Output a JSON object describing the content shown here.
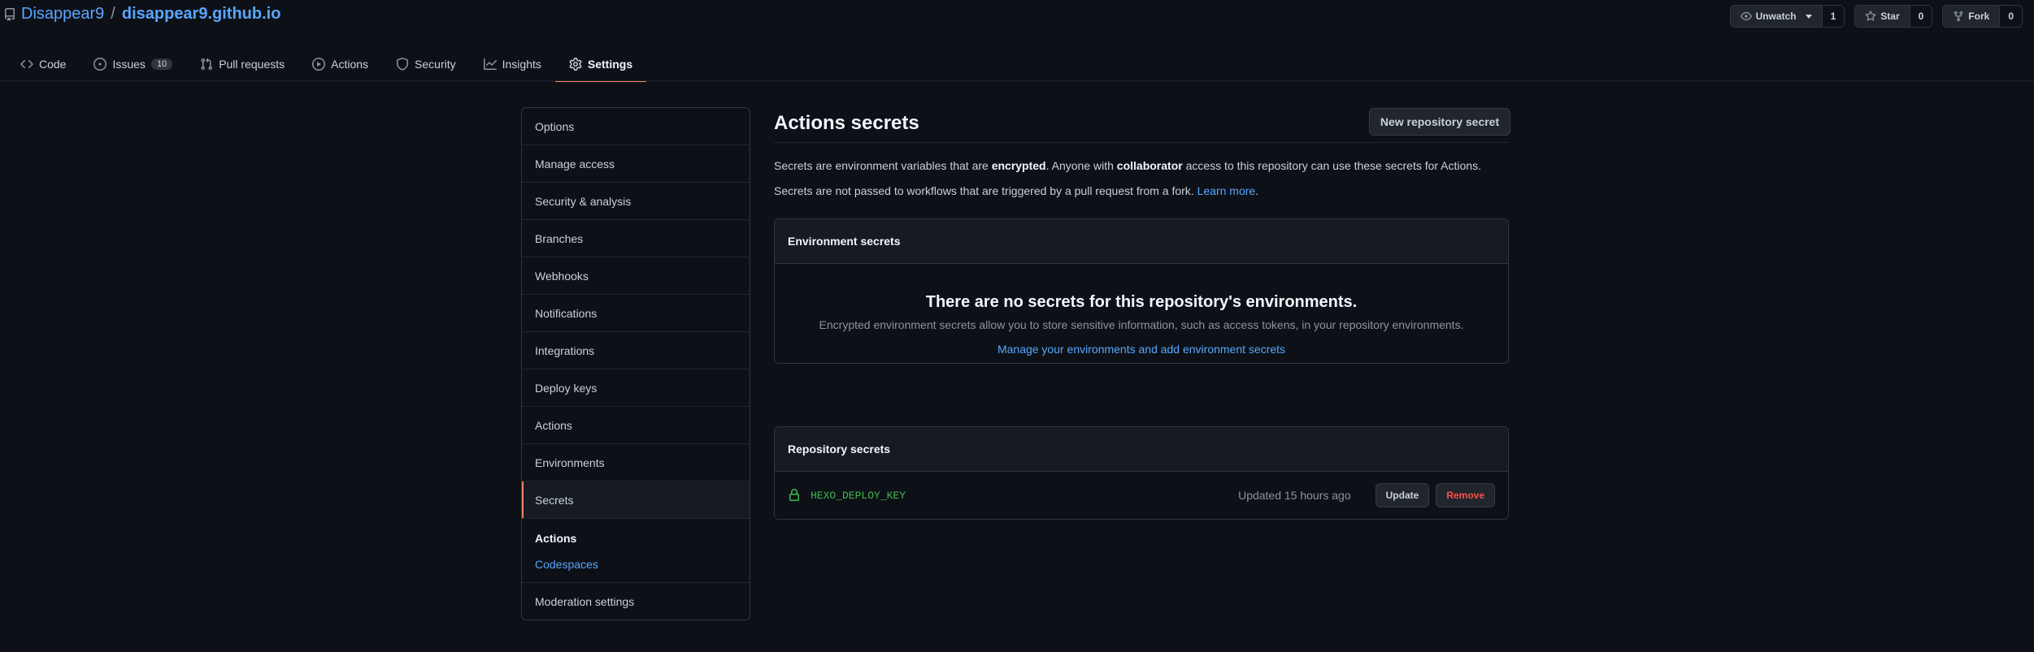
{
  "repo": {
    "owner": "Disappear9",
    "separator": "/",
    "name": "disappear9.github.io"
  },
  "header_actions": {
    "watch": {
      "label": "Unwatch",
      "count": "1"
    },
    "star": {
      "label": "Star",
      "count": "0"
    },
    "fork": {
      "label": "Fork",
      "count": "0"
    }
  },
  "tabs": [
    {
      "label": "Code",
      "icon": "code-icon"
    },
    {
      "label": "Issues",
      "icon": "issue-icon",
      "counter": "10"
    },
    {
      "label": "Pull requests",
      "icon": "pull-request-icon"
    },
    {
      "label": "Actions",
      "icon": "play-icon"
    },
    {
      "label": "Security",
      "icon": "shield-icon"
    },
    {
      "label": "Insights",
      "icon": "graph-icon"
    },
    {
      "label": "Settings",
      "icon": "gear-icon",
      "active": true
    }
  ],
  "sidebar": {
    "items": [
      {
        "label": "Options"
      },
      {
        "label": "Manage access"
      },
      {
        "label": "Security & analysis"
      },
      {
        "label": "Branches"
      },
      {
        "label": "Webhooks"
      },
      {
        "label": "Notifications"
      },
      {
        "label": "Integrations"
      },
      {
        "label": "Deploy keys"
      },
      {
        "label": "Actions"
      },
      {
        "label": "Environments"
      },
      {
        "label": "Secrets",
        "active": true
      }
    ],
    "sub_heading": "Actions",
    "sub_link": "Codespaces",
    "moderation": "Moderation settings"
  },
  "main": {
    "title": "Actions secrets",
    "new_button": "New repository secret",
    "para1": {
      "a": "Secrets are environment variables that are ",
      "b": "encrypted",
      "c": ". Anyone with ",
      "d": "collaborator",
      "e": " access to this repository can use these secrets for Actions."
    },
    "para2": {
      "text": "Secrets are not passed to workflows that are triggered by a pull request from a fork. ",
      "link": "Learn more",
      "end": "."
    },
    "env_box": {
      "heading": "Environment secrets",
      "blank_title": "There are no secrets for this repository's environments.",
      "blank_text": "Encrypted environment secrets allow you to store sensitive information, such as access tokens, in your repository environments.",
      "blank_link": "Manage your environments and add environment secrets"
    },
    "repo_box": {
      "heading": "Repository secrets",
      "secrets": [
        {
          "name": "HEXO_DEPLOY_KEY",
          "updated": "Updated 15 hours ago",
          "update_label": "Update",
          "remove_label": "Remove"
        }
      ]
    }
  },
  "colors": {
    "accent": "#f78166",
    "link": "#58a6ff",
    "secret": "#3fb950",
    "danger": "#f85149",
    "bg": "#0d1117"
  }
}
